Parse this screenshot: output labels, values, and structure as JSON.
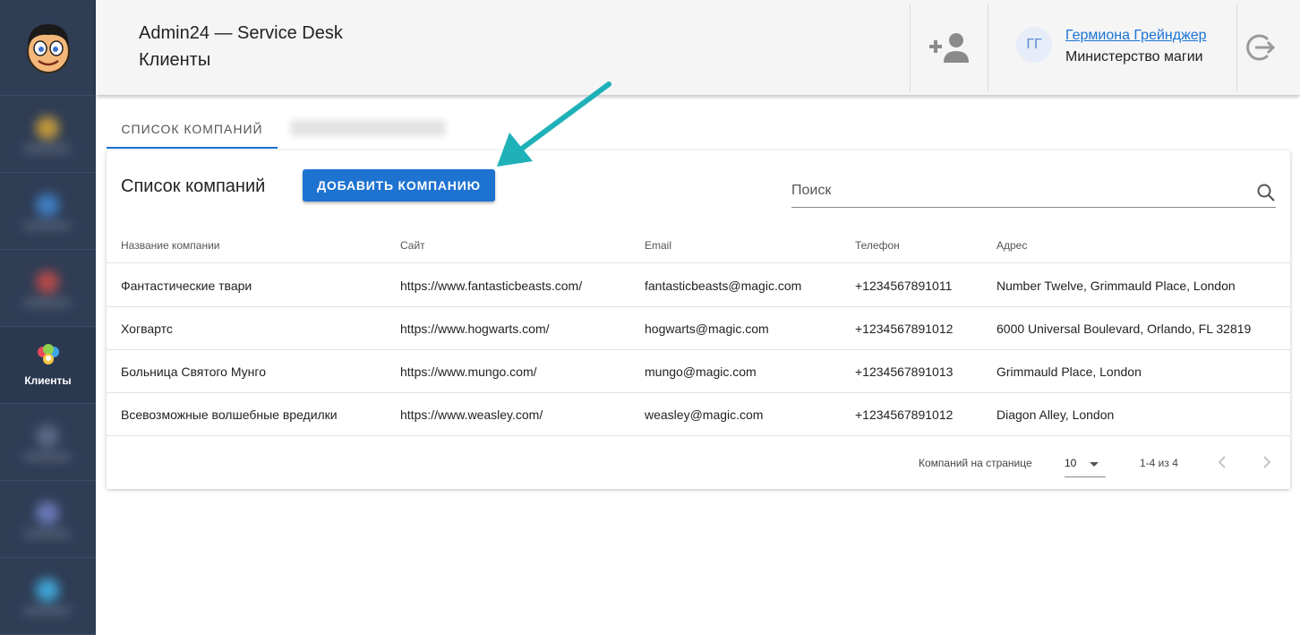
{
  "header": {
    "title": "Admin24 — Service Desk",
    "subtitle": "Клиенты",
    "user": {
      "initials": "ГГ",
      "name": "Гермиона Грейнджер",
      "org": "Министерство магии"
    }
  },
  "sidebar": {
    "active_label": "Клиенты",
    "icons": [
      "add-user-icon",
      "logout-icon",
      "clients-icon"
    ]
  },
  "tabs": [
    {
      "label": "СПИСОК КОМПАНИЙ",
      "active": true
    }
  ],
  "companies": {
    "title": "Список компаний",
    "add_button": "ДОБАВИТЬ КОМПАНИЮ",
    "search_placeholder": "Поиск",
    "columns": [
      "Название компании",
      "Сайт",
      "Email",
      "Телефон",
      "Адрес"
    ],
    "rows": [
      [
        "Фантастические твари",
        "https://www.fantasticbeasts.com/",
        "fantasticbeasts@magic.com",
        "+1234567891011",
        "Number Twelve, Grimmauld Place, London"
      ],
      [
        "Хогвартс",
        "https://www.hogwarts.com/",
        "hogwarts@magic.com",
        "+1234567891012",
        "6000 Universal Boulevard, Orlando, FL 32819"
      ],
      [
        "Больница Святого Мунго",
        "https://www.mungo.com/",
        "mungo@magic.com",
        "+1234567891013",
        "Grimmauld Place, London"
      ],
      [
        "Всевозможные волшебные вредилки",
        "https://www.weasley.com/",
        "weasley@magic.com",
        "+1234567891012",
        "Diagon Alley, London"
      ]
    ],
    "pagination": {
      "label": "Компаний на странице",
      "per_page": "10",
      "range": "1-4 из 4"
    }
  },
  "colors": {
    "accent": "#1e73d1",
    "sidebar": "#2f3d55",
    "annotation_arrow": "#1fb1b8"
  }
}
